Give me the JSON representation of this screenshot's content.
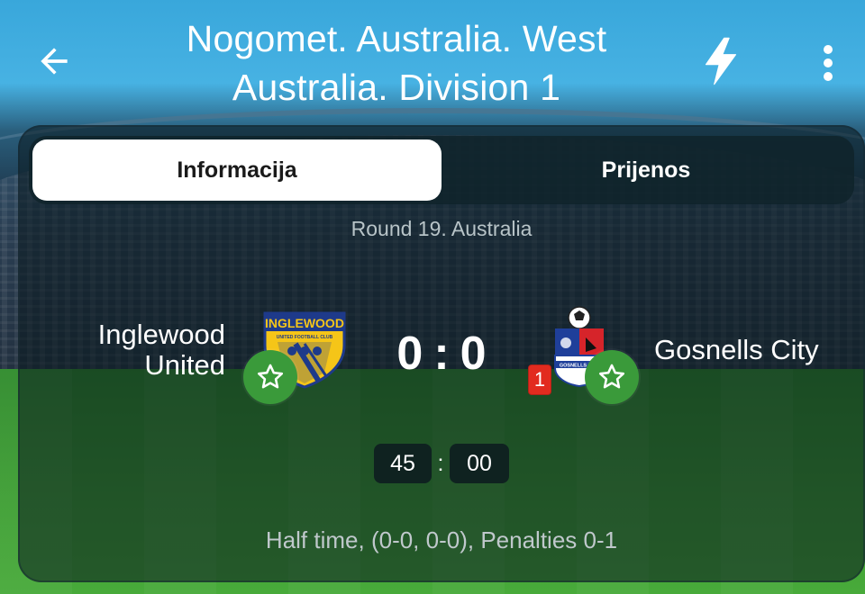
{
  "header": {
    "title": "Nogomet. Australia. West Australia. Division 1",
    "back_icon": "arrow-left-icon",
    "flash_icon": "lightning-icon",
    "more_icon": "more-vertical-icon"
  },
  "tabs": [
    {
      "label": "Informacija",
      "active": true
    },
    {
      "label": "Prijenos",
      "active": false
    }
  ],
  "match": {
    "round": "Round 19. Australia",
    "home_team": "Inglewood United",
    "away_team": "Gosnells City",
    "home_logo_text": "INGLEWOOD",
    "home_logo_subtext": "UNITED FOOTBALL CLUB",
    "away_logo_text": "GOSNELLS CITY",
    "home_score": "0",
    "score_separator": ":",
    "away_score": "0",
    "away_red_cards": "1",
    "clock_minutes": "45",
    "clock_separator": ":",
    "clock_seconds": "00",
    "status": "Half time, (0-0, 0-0), Penalties 0-1"
  },
  "colors": {
    "accent_green": "#3a9a3a",
    "red_card": "#e22b1f",
    "tab_active_bg": "#ffffff"
  }
}
